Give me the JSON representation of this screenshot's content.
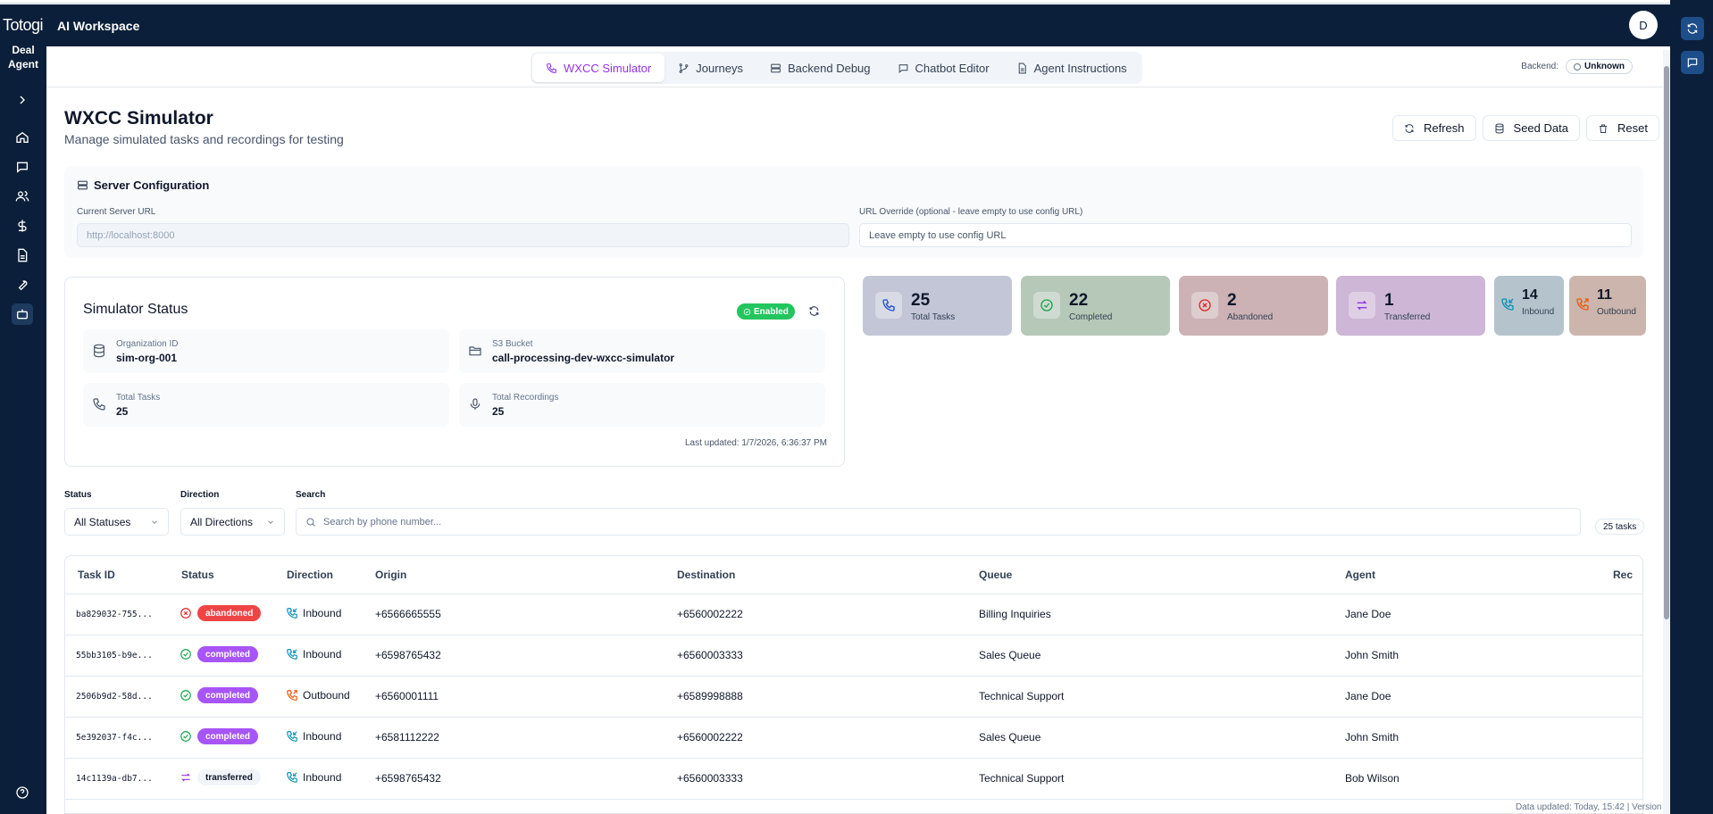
{
  "app": {
    "logo": "Totogi",
    "title": "AI Workspace",
    "brand_line1": "Deal",
    "brand_line2": "Agent",
    "user_initial": "D"
  },
  "sidebar": {
    "items": [
      "expand-icon",
      "home-icon",
      "chat-icon",
      "users-icon",
      "dollar-icon",
      "document-icon",
      "wrench-icon",
      "bot-icon",
      "help-icon"
    ]
  },
  "tabs": [
    {
      "label": "WXCC Simulator",
      "icon": "phone-icon"
    },
    {
      "label": "Journeys",
      "icon": "branch-icon"
    },
    {
      "label": "Backend Debug",
      "icon": "server-icon"
    },
    {
      "label": "Chatbot Editor",
      "icon": "message-icon"
    },
    {
      "label": "Agent Instructions",
      "icon": "file-icon"
    }
  ],
  "backend": {
    "label": "Backend:",
    "status": "Unknown"
  },
  "page": {
    "title": "WXCC Simulator",
    "subtitle": "Manage simulated tasks and recordings for testing"
  },
  "actions": {
    "refresh": "Refresh",
    "seed": "Seed Data",
    "reset": "Reset"
  },
  "server_config": {
    "title": "Server Configuration",
    "current_label": "Current Server URL",
    "current_placeholder": "http://localhost:8000",
    "override_label": "URL Override (optional - leave empty to use config URL)",
    "override_placeholder": "Leave empty to use config URL"
  },
  "simulator_status": {
    "title": "Simulator Status",
    "badge": "Enabled",
    "org_label": "Organization ID",
    "org_value": "sim-org-001",
    "bucket_label": "S3 Bucket",
    "bucket_value": "call-processing-dev-wxcc-simulator",
    "tasks_label": "Total Tasks",
    "tasks_value": "25",
    "recordings_label": "Total Recordings",
    "recordings_value": "25",
    "last_updated": "Last updated: 1/7/2026, 6:36:37 PM"
  },
  "stats": [
    {
      "value": "25",
      "caption": "Total Tasks",
      "bg": "#c3c6d6",
      "icon_color": "#1d4ed8"
    },
    {
      "value": "22",
      "caption": "Completed",
      "bg": "#b6c8b8",
      "icon_color": "#16a34a"
    },
    {
      "value": "2",
      "caption": "Abandoned",
      "bg": "#cdb2b5",
      "icon_color": "#dc2626"
    },
    {
      "value": "1",
      "caption": "Transferred",
      "bg": "#cdb6d6",
      "icon_color": "#9333ea"
    },
    {
      "value": "14",
      "caption": "Inbound",
      "bg": "#b5c4cc",
      "icon_color": "#0891b2"
    },
    {
      "value": "11",
      "caption": "Outbound",
      "bg": "#cbb5ac",
      "icon_color": "#ea580c"
    }
  ],
  "filters": {
    "status_label": "Status",
    "status_value": "All Statuses",
    "direction_label": "Direction",
    "direction_value": "All Directions",
    "search_label": "Search",
    "search_placeholder": "Search by phone number...",
    "count": "25 tasks"
  },
  "table": {
    "headers": [
      "Task ID",
      "Status",
      "Direction",
      "Origin",
      "Destination",
      "Queue",
      "Agent",
      "Rec"
    ],
    "rows": [
      {
        "id": "ba829032-755...",
        "status": "abandoned",
        "direction": "Inbound",
        "origin": "+6566665555",
        "destination": "+6560002222",
        "queue": "Billing Inquiries",
        "agent": "Jane Doe"
      },
      {
        "id": "55bb3105-b9e...",
        "status": "completed",
        "direction": "Inbound",
        "origin": "+6598765432",
        "destination": "+6560003333",
        "queue": "Sales Queue",
        "agent": "John Smith"
      },
      {
        "id": "2506b9d2-58d...",
        "status": "completed",
        "direction": "Outbound",
        "origin": "+6560001111",
        "destination": "+6589998888",
        "queue": "Technical Support",
        "agent": "Jane Doe"
      },
      {
        "id": "5e392037-f4c...",
        "status": "completed",
        "direction": "Inbound",
        "origin": "+6581112222",
        "destination": "+6560002222",
        "queue": "Sales Queue",
        "agent": "John Smith"
      },
      {
        "id": "14c1139a-db7...",
        "status": "transferred",
        "direction": "Inbound",
        "origin": "+6598765432",
        "destination": "+6560003333",
        "queue": "Technical Support",
        "agent": "Bob Wilson"
      }
    ]
  },
  "footer": "Data updated: Today, 15:42 | Version"
}
